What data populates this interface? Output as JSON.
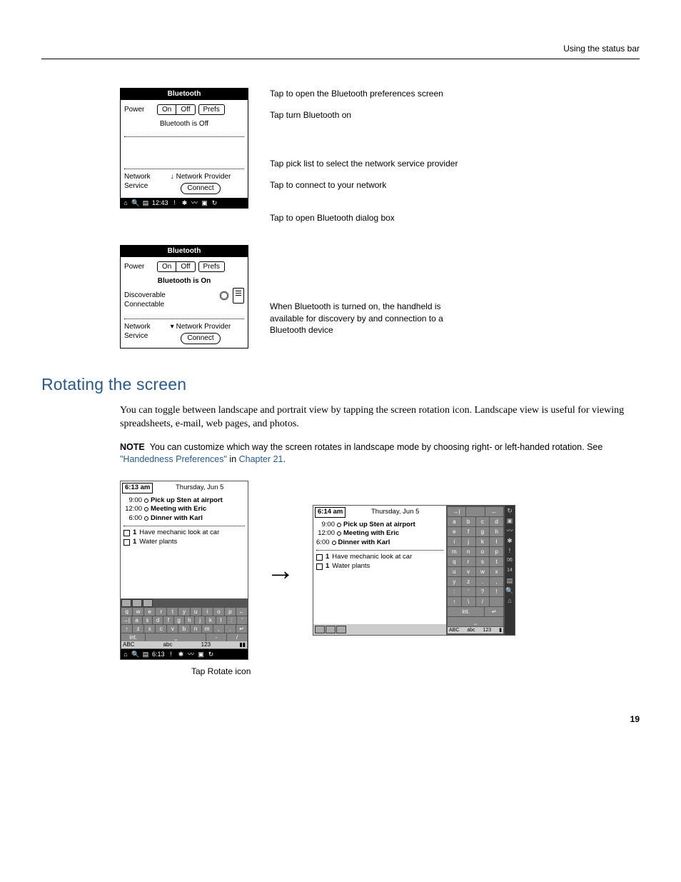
{
  "header": "Using the status bar",
  "page_number": "19",
  "bt_off": {
    "title": "Bluetooth",
    "power_label": "Power",
    "on": "On",
    "off": "Off",
    "prefs": "Prefs",
    "status": "Bluetooth is Off",
    "net_label": "Network\nService",
    "net_provider": "Network Provider",
    "connect": "Connect",
    "time": "12:43"
  },
  "callouts_off": {
    "prefs": "Tap to open the Bluetooth preferences screen",
    "on_toggle": "Tap turn Bluetooth on",
    "picklist": "Tap pick list to select the network service provider",
    "connect": "Tap to connect to your network",
    "bt_icon": "Tap to open Bluetooth dialog box"
  },
  "bt_on": {
    "title": "Bluetooth",
    "power_label": "Power",
    "on": "On",
    "off": "Off",
    "prefs": "Prefs",
    "status": "Bluetooth is On",
    "discover": "Discoverable",
    "connectable": "Connectable",
    "net_label": "Network\nService",
    "net_provider": "Network Provider",
    "connect": "Connect"
  },
  "callout_on": "When Bluetooth is turned on, the handheld is available for discovery by and connection to a Bluetooth device",
  "section_title": "Rotating the screen",
  "body1": "You can toggle between landscape and portrait view by tapping the screen rotation icon. Landscape view is useful for viewing spreadsheets, e-mail, web pages, and photos.",
  "note_label": "NOTE",
  "note_body": "You can customize which way the screen rotates in landscape mode by choosing right- or left-handed rotation. See ",
  "note_link1": "\"Handedness Preferences\"",
  "note_mid": " in ",
  "note_link2": "Chapter 21",
  "note_end": ".",
  "agenda": {
    "time_p": "6:13 am",
    "time_l": "6:14 am",
    "date": "Thursday, Jun 5",
    "items": [
      {
        "t": "9:00",
        "text": "Pick up Sten at airport"
      },
      {
        "t": "12:00",
        "text": "Meeting with Eric"
      },
      {
        "t": "6:00",
        "text": "Dinner with Karl"
      }
    ],
    "tasks": [
      {
        "p": "1",
        "text": "Have mechanic look at car"
      },
      {
        "p": "1",
        "text": "Water plants"
      }
    ],
    "sb_time": "6:13"
  },
  "kb": {
    "r1": [
      "q",
      "w",
      "e",
      "r",
      "t",
      "y",
      "u",
      "i",
      "o",
      "p",
      "←"
    ],
    "r2": [
      "→|",
      "a",
      "s",
      "d",
      "f",
      "g",
      "h",
      "j",
      "k",
      "l",
      ":",
      "'"
    ],
    "r3": [
      "↑",
      "z",
      "x",
      "c",
      "v",
      "b",
      "n",
      "m",
      ",",
      ".",
      "↵"
    ],
    "r4_int": "int.",
    "modes": [
      "ABC",
      "abc",
      "123"
    ]
  },
  "lkb": {
    "r1": [
      "→|",
      "",
      "←"
    ],
    "r2": [
      "a",
      "b",
      "c",
      "d"
    ],
    "r3": [
      "e",
      "f",
      "g",
      "h"
    ],
    "r4": [
      "i",
      "j",
      "k",
      "l"
    ],
    "r5": [
      "m",
      "n",
      "o",
      "p"
    ],
    "r6": [
      "q",
      "r",
      "s",
      "t"
    ],
    "r7": [
      "u",
      "v",
      "w",
      "x"
    ],
    "r8": [
      "y",
      "z",
      ".",
      ","
    ],
    "r9": [
      ":",
      "'",
      "?",
      "!"
    ],
    "r10": [
      "↑",
      "\\",
      "/",
      ""
    ],
    "r11_int": "int.",
    "r11_ret": "↵",
    "modes": [
      "ABC",
      "abc",
      "123"
    ]
  },
  "side_nums": [
    "06",
    "14"
  ],
  "rotate_caption": "Tap Rotate icon"
}
